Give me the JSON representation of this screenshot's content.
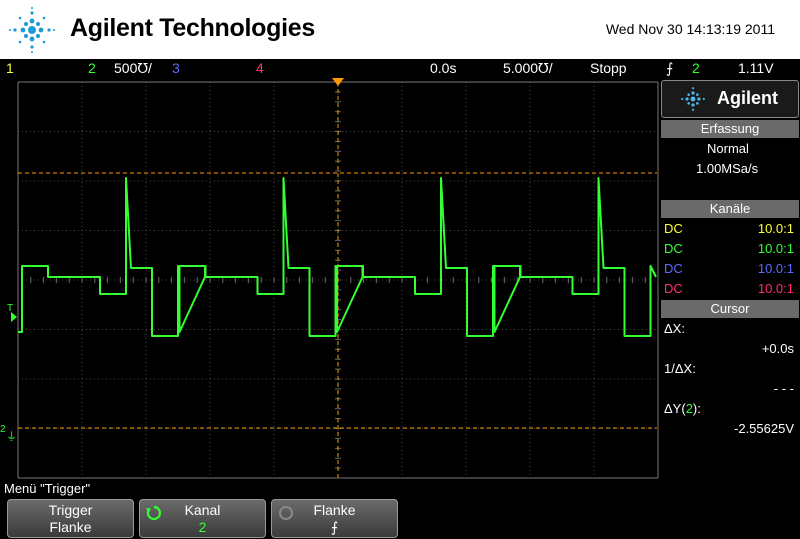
{
  "header": {
    "brand": "Agilent Technologies",
    "datetime": "Wed Nov 30 14:13:19 2011"
  },
  "statusbar": {
    "ch1_label": "1",
    "ch2_label": "2",
    "ch2_scale": "500℧/",
    "ch3_label": "3",
    "ch4_label": "4",
    "time_delay": "0.0s",
    "time_scale": "5.000℧/",
    "run_state": "Stopp",
    "trigger_slope_glyph": "⨍",
    "trigger_channel": "2",
    "trigger_level": "1.11V"
  },
  "screen": {
    "trigger_marker": "T",
    "ground_marker": "2",
    "ground_symbol": "⏚"
  },
  "panel": {
    "logo_text": "Agilent",
    "acquisition": {
      "title": "Erfassung",
      "mode": "Normal",
      "rate": "1.00MSa/s"
    },
    "channels": {
      "title": "Kanäle",
      "rows": [
        {
          "coupling": "DC",
          "probe": "10.0:1",
          "color": "#ffff3a"
        },
        {
          "coupling": "DC",
          "probe": "10.0:1",
          "color": "#33ff33"
        },
        {
          "coupling": "DC",
          "probe": "10.0:1",
          "color": "#5d6bff"
        },
        {
          "coupling": "DC",
          "probe": "10.0:1",
          "color": "#ff2f6e"
        }
      ]
    },
    "cursor": {
      "title": "Cursor",
      "dx_label": "ΔX:",
      "dx_value": "+0.0s",
      "inv_dx_label": "1/ΔX:",
      "inv_dx_value": "- - -",
      "dy_label_prefix": "ΔY(",
      "dy_channel": "2",
      "dy_label_suffix": "):",
      "dy_value": "-2.55625V"
    }
  },
  "menu": {
    "title": "Menü \"Trigger\"",
    "softkeys": [
      {
        "label": "Trigger",
        "value": "Flanke"
      },
      {
        "label": "Kanal",
        "value": "2"
      },
      {
        "label": "Flanke",
        "value": "⨍"
      }
    ]
  },
  "colors": {
    "ch1": "#ffff3a",
    "ch2": "#33ff33",
    "ch3": "#5d6bff",
    "ch4": "#ff2f6e",
    "cursor": "#ff9900",
    "grid": "#555555"
  }
}
